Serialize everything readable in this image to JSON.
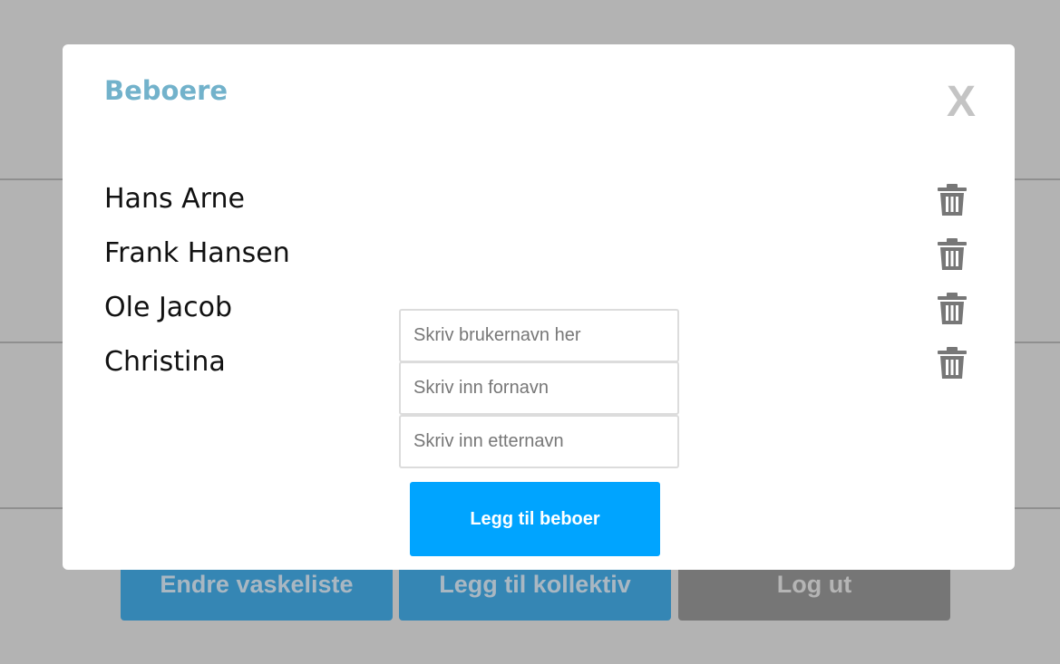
{
  "background": {
    "buttons": {
      "change_laundry_list": "Endre vaskeliste",
      "add_collective": "Legg til kollektiv",
      "logout": "Log ut"
    }
  },
  "modal": {
    "title": "Beboere",
    "close_label": "X",
    "residents": [
      {
        "name": "Hans Arne"
      },
      {
        "name": "Frank Hansen"
      },
      {
        "name": "Ole Jacob"
      },
      {
        "name": "Christina"
      }
    ],
    "form": {
      "username_placeholder": "Skriv brukernavn her",
      "firstname_placeholder": "Skriv inn fornavn",
      "lastname_placeholder": "Skriv inn etternavn",
      "submit_label": "Legg til beboer"
    }
  },
  "icons": {
    "delete": "trash-icon",
    "close": "close-icon"
  },
  "colors": {
    "title": "#72b2cb",
    "primary_button": "#00a4ff",
    "overlay": "#b3b3b3"
  }
}
